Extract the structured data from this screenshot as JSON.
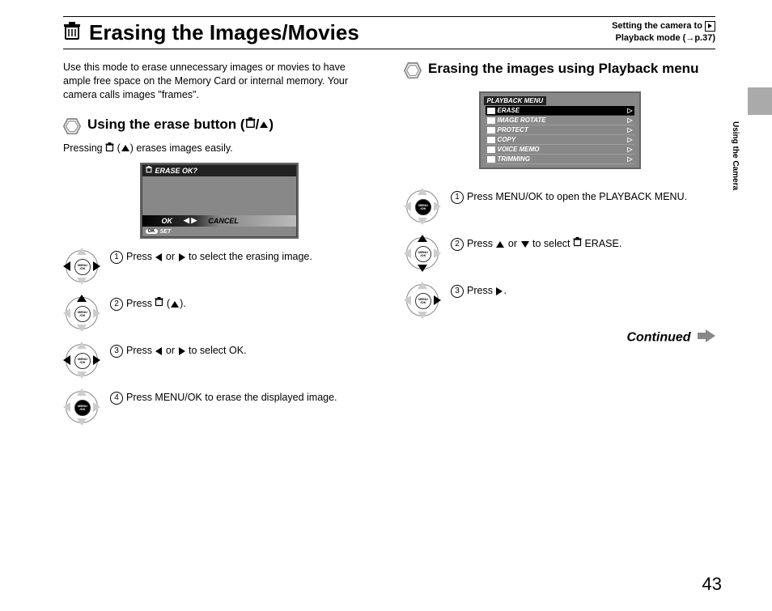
{
  "header": {
    "title": "Erasing the Images/Movies",
    "setting_line1": "Setting the camera to ",
    "setting_line2_pre": "Playback mode (",
    "setting_line2_post": "p.37)"
  },
  "sidebar": {
    "section_label": "Using the Camera"
  },
  "left": {
    "intro": "Use this mode to erase unnecessary images or movies to have ample free space on the Memory Card or internal memory. Your camera calls images \"frames\".",
    "section_title_pre": "Using the erase button (",
    "section_title_post": ")",
    "sub_pre": "Pressing ",
    "sub_mid": " (",
    "sub_post": ") erases images easily.",
    "screen": {
      "prompt": "ERASE OK?",
      "ok": "OK",
      "cancel": "CANCEL",
      "ok_pill": "OK",
      "set": "SET"
    },
    "steps": [
      {
        "n": "1",
        "pre": "Press ",
        "mid": " or ",
        "post": " to select the erasing image."
      },
      {
        "n": "2",
        "pre": "Press ",
        "mid": " (",
        "post": ")."
      },
      {
        "n": "3",
        "pre": "Press ",
        "mid": " or ",
        "post": " to select OK."
      },
      {
        "n": "4",
        "pre": "Press MENU/OK to erase the displayed image.",
        "mid": "",
        "post": ""
      }
    ]
  },
  "right": {
    "section_title": "Erasing the images using Playback menu",
    "menu": {
      "title": "PLAYBACK MENU",
      "items": [
        {
          "label": "ERASE",
          "selected": true
        },
        {
          "label": "IMAGE ROTATE",
          "selected": false
        },
        {
          "label": "PROTECT",
          "selected": false
        },
        {
          "label": "COPY",
          "selected": false
        },
        {
          "label": "VOICE MEMO",
          "selected": false
        },
        {
          "label": "TRIMMING",
          "selected": false
        }
      ]
    },
    "steps": [
      {
        "n": "1",
        "text": "Press MENU/OK to open the PLAYBACK MENU."
      },
      {
        "n": "2",
        "pre": "Press ",
        "mid": " or ",
        "post": " to select ",
        "post2": " ERASE."
      },
      {
        "n": "3",
        "pre": "Press ",
        "post": "."
      }
    ],
    "continued": "Continued"
  },
  "page_number": "43"
}
